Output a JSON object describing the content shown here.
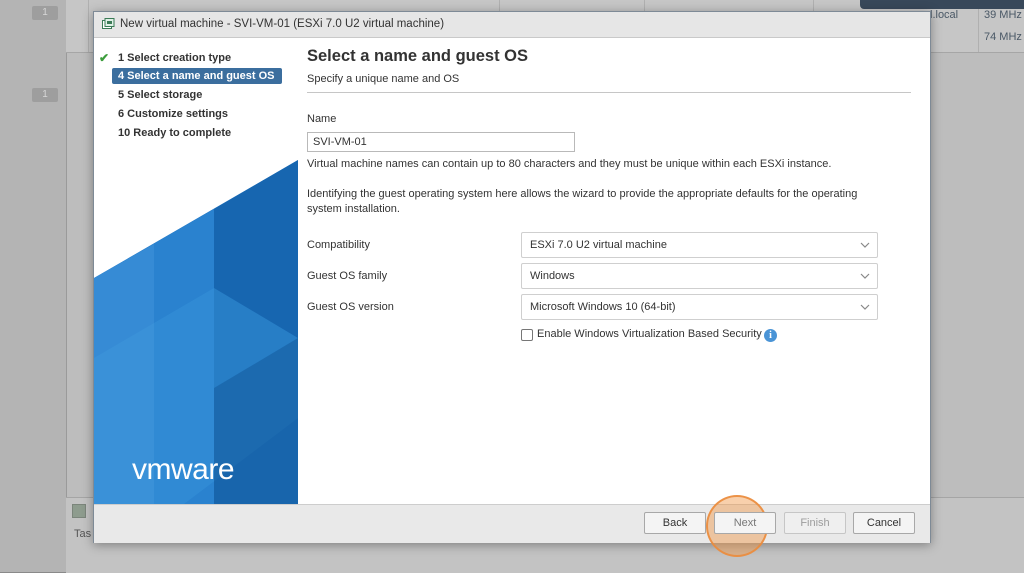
{
  "background": {
    "badges": [
      "1",
      "1"
    ],
    "cells": {
      "host_suffix": "l.local",
      "mhz_1": "39 MHz",
      "mhz_2": "74 MHz"
    },
    "bottom_panel_label": "Tas"
  },
  "dialog": {
    "title": "New virtual machine - SVI-VM-01 (ESXi 7.0 U2 virtual machine)",
    "steps": [
      {
        "label": "1  Select creation type",
        "state": "done"
      },
      {
        "label": "4  Select a name and guest OS",
        "state": "active"
      },
      {
        "label": "5  Select storage",
        "state": "pending"
      },
      {
        "label": "6  Customize settings",
        "state": "pending"
      },
      {
        "label": "10  Ready to complete",
        "state": "pending"
      }
    ],
    "brand": "vmware"
  },
  "content": {
    "heading": "Select a name and guest OS",
    "subheading": "Specify a unique name and OS",
    "name_label": "Name",
    "name_value": "SVI-VM-01",
    "name_help": "Virtual machine names can contain up to 80 characters and they must be unique within each ESXi instance.",
    "guest_help": "Identifying the guest operating system here allows the wizard to provide the appropriate defaults for the operating system installation.",
    "compatibility": {
      "label": "Compatibility",
      "value": "ESXi 7.0 U2 virtual machine"
    },
    "os_family": {
      "label": "Guest OS family",
      "value": "Windows"
    },
    "os_version": {
      "label": "Guest OS version",
      "value": "Microsoft Windows 10 (64-bit)"
    },
    "vbs": {
      "label": "Enable Windows Virtualization Based Security",
      "checked": false
    }
  },
  "footer": {
    "back": "Back",
    "next": "Next",
    "finish": "Finish",
    "cancel": "Cancel"
  },
  "colors": {
    "accent": "#3b6e9e",
    "brand_blue": "#1d73c2",
    "check_green": "#3c9d3c",
    "highlight": "#f09646"
  }
}
